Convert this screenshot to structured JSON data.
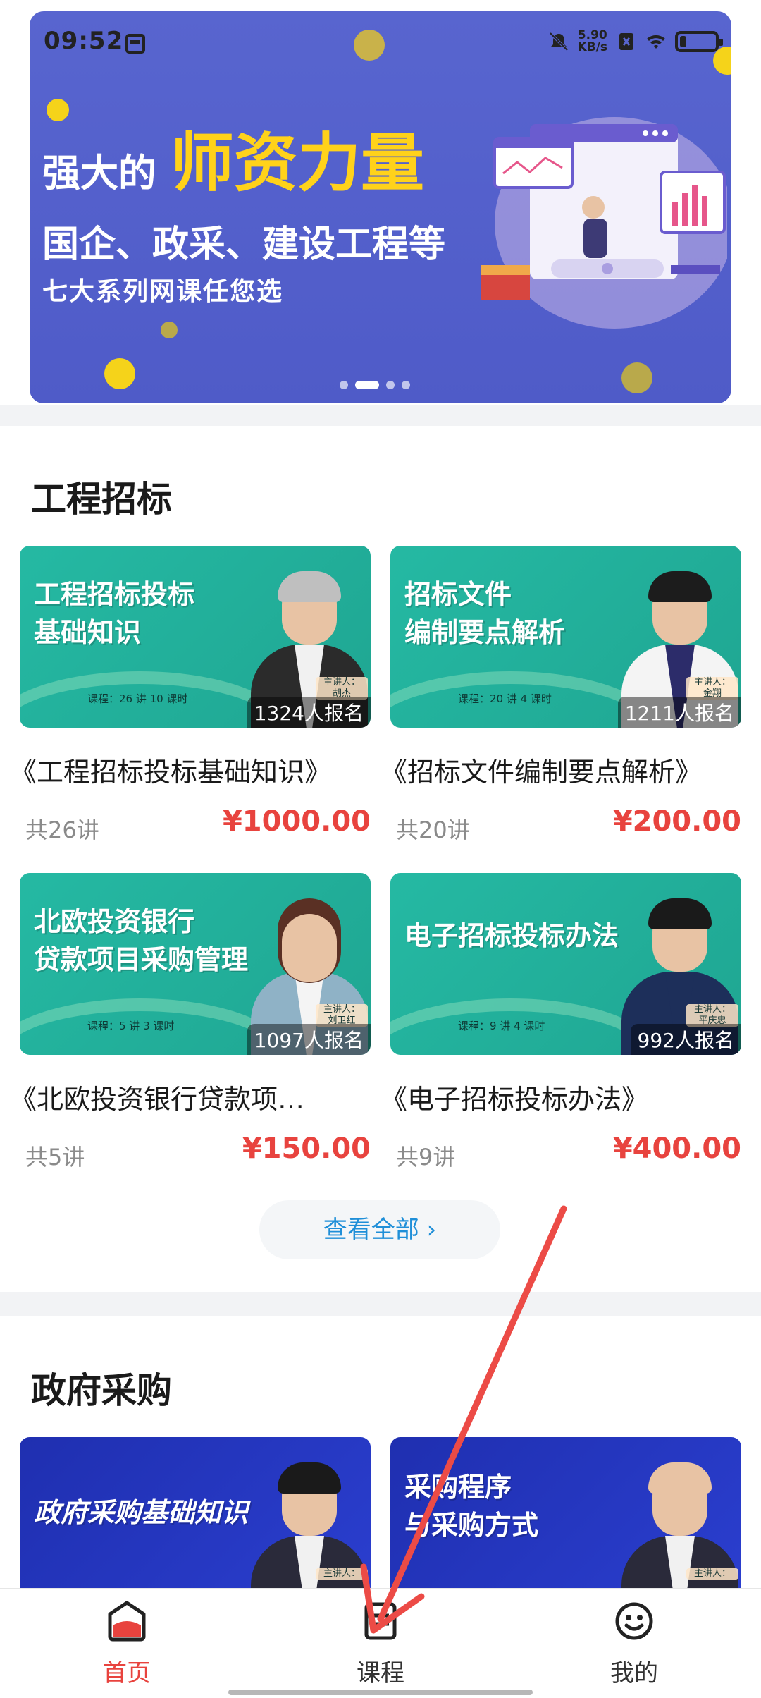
{
  "status_bar": {
    "time": "09:52",
    "net_speed_value": "5.90",
    "net_speed_unit": "KB/s",
    "battery_percent": 16
  },
  "banner": {
    "line1_prefix": "强大的",
    "line1_highlight": "师资力量",
    "line2": "国企、政采、建设工程等",
    "line3": "七大系列网课任您选",
    "page_count": 4,
    "active_page": 1
  },
  "section1": {
    "title": "工程招标",
    "courses": [
      {
        "thumb_title": "工程招标投标\n基础知识",
        "thumb_meta": "课程：26 讲 10 课时",
        "speaker_label": "主讲人：",
        "speaker": "胡杰",
        "enrolled": "1324人报名",
        "name": "《工程招标投标基础知识》",
        "lessons": "共26讲",
        "price": "¥1000.00"
      },
      {
        "thumb_title": "招标文件\n编制要点解析",
        "thumb_meta": "课程：20 讲 4 课时",
        "speaker_label": "主讲人：",
        "speaker": "金翔",
        "enrolled": "1211人报名",
        "name": "《招标文件编制要点解析》",
        "lessons": "共20讲",
        "price": "¥200.00"
      },
      {
        "thumb_title": "北欧投资银行\n贷款项目采购管理",
        "thumb_meta": "课程：5 讲 3 课时",
        "speaker_label": "主讲人：",
        "speaker": "刘卫红",
        "enrolled": "1097人报名",
        "name": "《北欧投资银行贷款项…",
        "lessons": "共5讲",
        "price": "¥150.00"
      },
      {
        "thumb_title": "电子招标投标办法",
        "thumb_meta": "课程：9 讲 4 课时",
        "speaker_label": "主讲人：",
        "speaker": "平庆忠",
        "enrolled": "992人报名",
        "name": "《电子招标投标办法》",
        "lessons": "共9讲",
        "price": "¥400.00"
      }
    ],
    "view_all": "查看全部 ›"
  },
  "section2": {
    "title": "政府采购",
    "courses": [
      {
        "thumb_title": "政府采购基础知识",
        "speaker_label": "主讲人："
      },
      {
        "thumb_title": "采购程序\n与采购方式",
        "speaker_label": "主讲人："
      }
    ]
  },
  "tabbar": {
    "items": [
      {
        "label": "首页",
        "icon": "home-icon",
        "active": true
      },
      {
        "label": "课程",
        "icon": "course-icon",
        "active": false
      },
      {
        "label": "我的",
        "icon": "smiley-icon",
        "active": false
      }
    ]
  },
  "colors": {
    "accent": "#e8433e",
    "banner_bg": "#5865cf",
    "link": "#1f8fd8",
    "card_teal": "#25b9a3",
    "card_blue": "#2b3fd0"
  }
}
